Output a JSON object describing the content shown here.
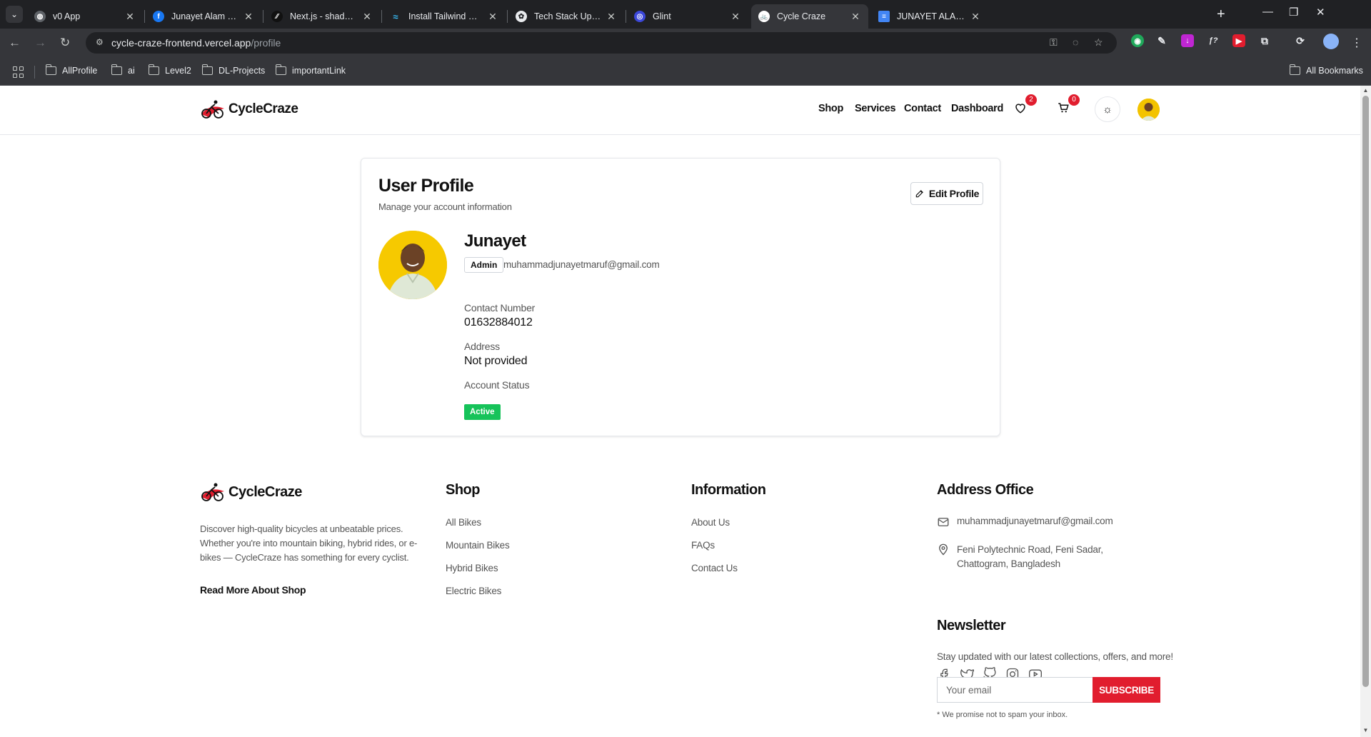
{
  "browser": {
    "tabs": [
      {
        "title": "v0 App",
        "favicon": "globe-icon",
        "color": "#9aa0a6",
        "active": false
      },
      {
        "title": "Junayet Alam | Facebook",
        "favicon": "facebook-icon",
        "color": "#1877f2",
        "active": false
      },
      {
        "title": "Next.js - shadcn/ui",
        "favicon": "shadcn-icon",
        "color": "#111111",
        "active": false
      },
      {
        "title": "Install Tailwind CSS with Ne",
        "favicon": "tailwind-icon",
        "color": "#38bdf8",
        "active": false
      },
      {
        "title": "Tech Stack Update",
        "favicon": "openai-icon",
        "color": "#e8eaed",
        "active": false
      },
      {
        "title": "Glint",
        "favicon": "glint-icon",
        "color": "#7c8cff",
        "active": false
      },
      {
        "title": "Cycle Craze",
        "favicon": "cyclecraze-icon",
        "color": "#e11d2e",
        "active": true
      },
      {
        "title": "JUNAYET ALAM - Google",
        "favicon": "google-docs-icon",
        "color": "#4285f4",
        "active": false
      }
    ],
    "url_host": "cycle-craze-frontend.vercel.app",
    "url_path": "/profile",
    "bookmarks": [
      "AllProfile",
      "ai",
      "Level2",
      "DL-Projects",
      "importantLink"
    ],
    "all_bookmarks_label": "All Bookmarks"
  },
  "site": {
    "brand": "CycleCraze",
    "brand_color": "#e11d2e",
    "nav": [
      "Shop",
      "Services",
      "Contact",
      "Dashboard"
    ],
    "wishlist_count": "2",
    "cart_count": "0"
  },
  "profile": {
    "title": "User Profile",
    "subtitle": "Manage your account information",
    "edit_label": "Edit Profile",
    "name": "Junayet",
    "role": "Admin",
    "email": "muhammadjunayetmaruf@gmail.com",
    "contact_label": "Contact Number",
    "contact_value": "01632884012",
    "address_label": "Address",
    "address_value": "Not provided",
    "status_label": "Account Status",
    "status_value": "Active",
    "status_color": "#16c35a"
  },
  "footer": {
    "brand": "CycleCraze",
    "description": "Discover high-quality bicycles at unbeatable prices. Whether you're into mountain biking, hybrid rides, or e-bikes — CycleCraze has something for every cyclist.",
    "read_more": "Read More About Shop",
    "shop_heading": "Shop",
    "shop_links": [
      "All Bikes",
      "Mountain Bikes",
      "Hybrid Bikes",
      "Electric Bikes"
    ],
    "info_heading": "Information",
    "info_links": [
      "About Us",
      "FAQs",
      "Contact Us"
    ],
    "office_heading": "Address Office",
    "office_email": "muhammadjunayetmaruf@gmail.com",
    "office_address": "Feni Polytechnic Road, Feni Sadar, Chattogram, Bangladesh",
    "social_icons": [
      "facebook-icon",
      "twitter-icon",
      "github-icon",
      "instagram-icon",
      "youtube-icon"
    ],
    "newsletter_heading": "Newsletter",
    "newsletter_text": "Stay updated with our latest collections, offers, and more!",
    "email_placeholder": "Your email",
    "subscribe_label": "SUBSCRIBE",
    "promise": "* We promise not to spam your inbox."
  }
}
